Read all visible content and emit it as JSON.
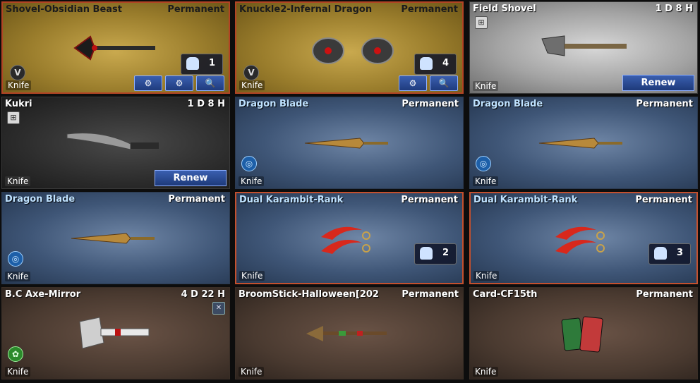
{
  "cards": [
    {
      "name": "Shovel-Obsidian Beast",
      "duration": "Permanent",
      "type": "Knife",
      "qty": "1",
      "badge": "V",
      "buttons": [
        "⚙",
        "⚙",
        "🔍"
      ]
    },
    {
      "name": "Knuckle2-Infernal Dragon",
      "duration": "Permanent",
      "type": "Knife",
      "qty": "4",
      "badge": "V",
      "buttons": [
        "⚙",
        "🔍"
      ]
    },
    {
      "name": "Field Shovel",
      "duration": "1 D  8 H",
      "type": "Knife",
      "action": "Renew"
    },
    {
      "name": "Kukri",
      "duration": "1 D  8 H",
      "type": "Knife",
      "action": "Renew"
    },
    {
      "name": "Dragon Blade",
      "duration": "Permanent",
      "type": "Knife"
    },
    {
      "name": "Dragon Blade",
      "duration": "Permanent",
      "type": "Knife"
    },
    {
      "name": "Dragon Blade",
      "duration": "Permanent",
      "type": "Knife"
    },
    {
      "name": "Dual Karambit-Rank",
      "duration": "Permanent",
      "type": "Knife",
      "qty": "2"
    },
    {
      "name": "Dual Karambit-Rank",
      "duration": "Permanent",
      "type": "Knife",
      "qty": "3"
    },
    {
      "name": "B.C Axe-Mirror",
      "duration": "4 D  22 H",
      "type": "Knife"
    },
    {
      "name": "BroomStick-Halloween[202",
      "duration": "Permanent",
      "type": "Knife"
    },
    {
      "name": "Card-CF15th",
      "duration": "Permanent",
      "type": "Knife"
    }
  ],
  "icons": {
    "gift": "gift-icon",
    "trash": "trash-icon",
    "search": "search-icon",
    "settings": "gear-icon",
    "wrench": "wrench-gear-icon",
    "rank": "v-rank-icon",
    "ring": "target-ring-icon",
    "clover": "green-clover-icon"
  }
}
